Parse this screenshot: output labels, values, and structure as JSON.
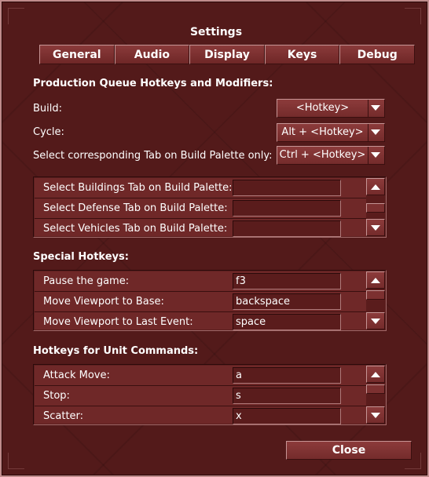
{
  "window": {
    "title": "Settings"
  },
  "tabs": [
    "General",
    "Audio",
    "Display",
    "Keys",
    "Debug"
  ],
  "production": {
    "heading": "Production Queue Hotkeys and Modifiers:",
    "build_label": "Build:",
    "build_value": "<Hotkey>",
    "cycle_label": "Cycle:",
    "cycle_value": "Alt + <Hotkey>",
    "select_tab_label": "Select corresponding Tab on Build Palette only:",
    "select_tab_value": "Ctrl + <Hotkey>",
    "list": [
      {
        "label": "Select Buildings Tab on Build Palette:",
        "value": ""
      },
      {
        "label": "Select Defense Tab on Build Palette:",
        "value": ""
      },
      {
        "label": "Select Vehicles Tab on Build Palette:",
        "value": ""
      }
    ]
  },
  "special": {
    "heading": "Special Hotkeys:",
    "list": [
      {
        "label": "Pause the game:",
        "value": "f3"
      },
      {
        "label": "Move Viewport to Base:",
        "value": "backspace"
      },
      {
        "label": "Move Viewport to Last Event:",
        "value": "space"
      }
    ]
  },
  "unit": {
    "heading": "Hotkeys for Unit Commands:",
    "list": [
      {
        "label": "Attack Move:",
        "value": "a"
      },
      {
        "label": "Stop:",
        "value": "s"
      },
      {
        "label": "Scatter:",
        "value": "x"
      }
    ]
  },
  "footer": {
    "close_label": "Close"
  },
  "icons": {
    "dropdown": "triangle-down-icon",
    "scroll_up": "triangle-up-icon",
    "scroll_down": "triangle-down-icon"
  },
  "colors": {
    "panel": "#531a1a",
    "button": "#8c3b3b",
    "border_light": "#c69595",
    "text": "#ffffff"
  }
}
